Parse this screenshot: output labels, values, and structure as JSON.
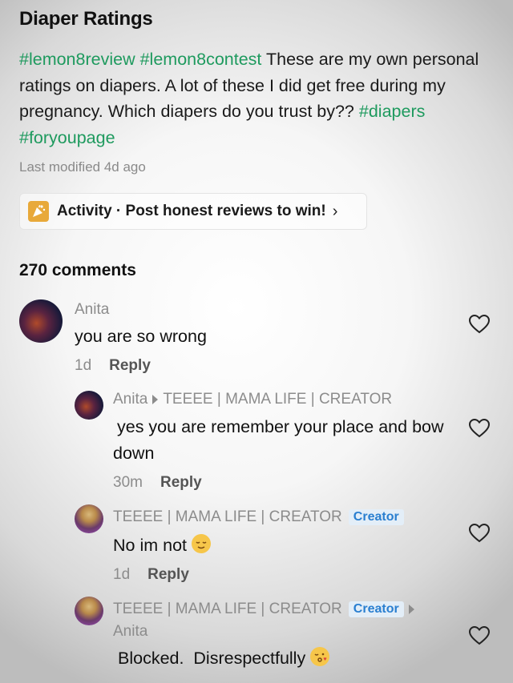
{
  "post": {
    "title": "Diaper Ratings",
    "tag1": "#lemon8review",
    "tag2": "#lemon8contest",
    "body": "These are my own personal ratings on diapers. A lot of these I did get free during my pregnancy. Which diapers do you trust by??",
    "tag3": "#diapers",
    "tag4": "#foryoupage",
    "last_modified": "Last modified 4d ago"
  },
  "activity": {
    "label": "Activity · Post honest reviews to win!",
    "chevron": "›",
    "icon": "party-popper-icon"
  },
  "comments_header": "270 comments",
  "comments": [
    {
      "author": "Anita",
      "text": "you are so wrong",
      "time": "1d",
      "reply_label": "Reply"
    },
    {
      "author": "Anita",
      "reply_to": "TEEEE | MAMA LIFE | CREATOR",
      "text": "yes you are remember your place and bow down",
      "time": "30m",
      "reply_label": "Reply"
    },
    {
      "author": "TEEEE | MAMA LIFE | CREATOR",
      "badge": "Creator",
      "text": "No im not",
      "emoji": "relieved-face",
      "time": "1d",
      "reply_label": "Reply"
    },
    {
      "author": "TEEEE | MAMA LIFE | CREATOR",
      "badge": "Creator",
      "reply_to": "Anita",
      "text": "Blocked.  Disrespectfully",
      "emoji": "kissing-face"
    }
  ],
  "colors": {
    "hashtag": "#1e9a5e",
    "badge_text": "#2a7fd0",
    "badge_bg": "#e3eef8",
    "muted": "#8c8c8c"
  }
}
